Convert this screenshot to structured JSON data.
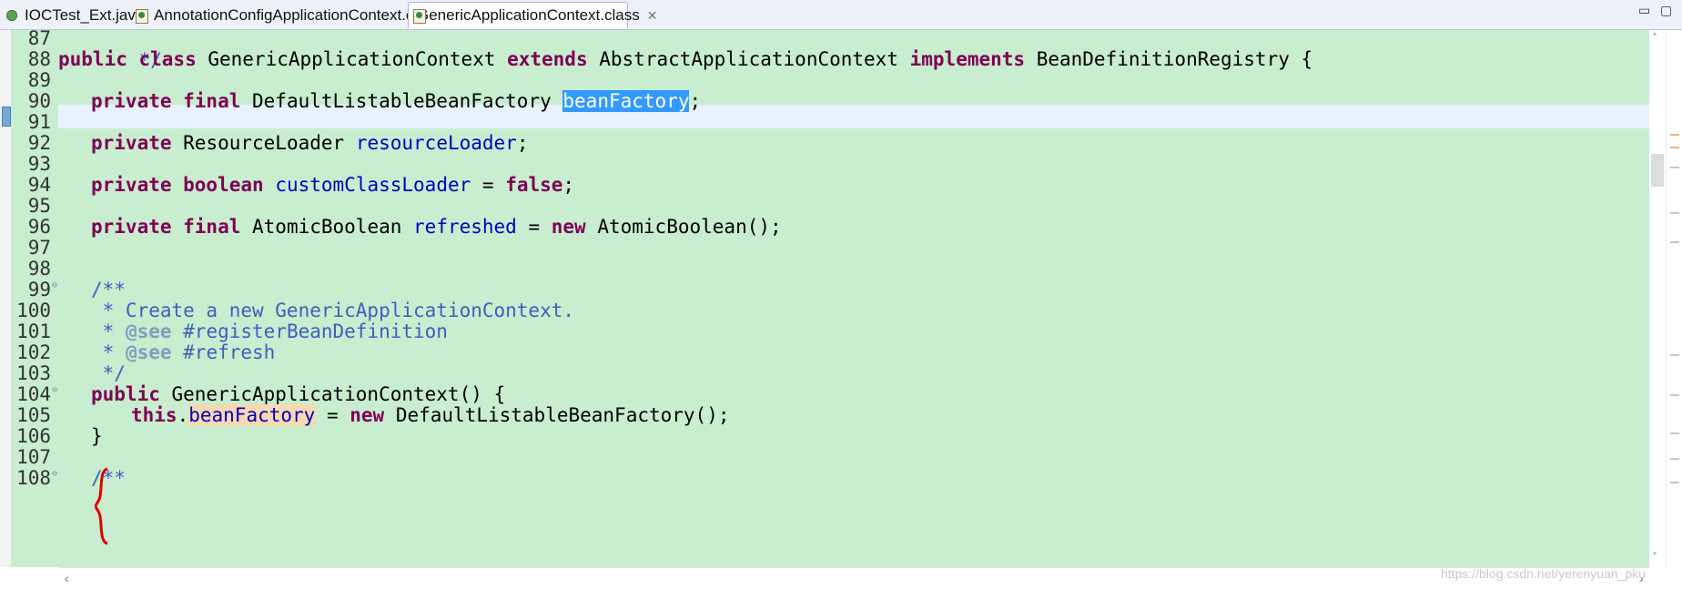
{
  "tabs": [
    {
      "label": "IOCTest_Ext.java",
      "icon": "java-file-icon"
    },
    {
      "label": "AnnotationConfigApplicationContext.class",
      "icon": "class-file-icon"
    },
    {
      "label": "GenericApplicationContext.class",
      "icon": "class-file-icon",
      "active": true,
      "close": "✕"
    }
  ],
  "window_buttons": {
    "minimize": "▭",
    "maximize": "▢"
  },
  "line_numbers": [
    "87",
    "88",
    "89",
    "90",
    "91",
    "92",
    "93",
    "94",
    "95",
    "96",
    "97",
    "98",
    "99",
    "100",
    "101",
    "102",
    "103",
    "104",
    "105",
    "106",
    "107",
    "108"
  ],
  "code": {
    "l87": " */",
    "l88": {
      "k1": "public class",
      "t1": " GenericApplicationContext ",
      "k2": "extends",
      "t2": " AbstractApplicationContext ",
      "k3": "implements",
      "t3": " BeanDefinitionRegistry {"
    },
    "l90": {
      "k1": "private final",
      "t1": " DefaultListableBeanFactory ",
      "sel": "beanFactory",
      "t2": ";"
    },
    "l92": {
      "k1": "private",
      "t1": " ResourceLoader ",
      "f1": "resourceLoader",
      "t2": ";"
    },
    "l94": {
      "k1": "private boolean",
      "sp": " ",
      "f1": "customClassLoader",
      "t1": " = ",
      "k2": "false",
      "t2": ";"
    },
    "l96": {
      "k1": "private final",
      "t1": " AtomicBoolean ",
      "f1": "refreshed",
      "t2": " = ",
      "k2": "new",
      "t3": " AtomicBoolean();"
    },
    "l99": "/**",
    "l100": " * Create a new GenericApplicationContext.",
    "l101": {
      "pre": " * ",
      "tag": "@see",
      "post": " #registerBeanDefinition"
    },
    "l102": {
      "pre": " * ",
      "tag": "@see",
      "post": " #refresh"
    },
    "l103": " */",
    "l104": {
      "k1": "public",
      "t1": " GenericApplicationContext() {"
    },
    "l105": {
      "k1": "this",
      "t1": ".",
      "occ": "beanFactory",
      "t2": " = ",
      "k2": "new",
      "t3": " DefaultListableBeanFactory();"
    },
    "l106": "}",
    "l108": "/**"
  },
  "watermark": "https://blog.csdn.net/yerenyuan_pku",
  "scroll_arrows": {
    "left": "‹",
    "right": "›",
    "up": "˄",
    "down": "˅"
  },
  "colors": {
    "editor_bg": "#c8edcf",
    "keyword": "#7f0055",
    "field": "#0000c0",
    "comment": "#3f5fbf",
    "selection": "#3399ff",
    "occurrence": "#f6d9b0",
    "bracket_annotation": "#e00000"
  }
}
